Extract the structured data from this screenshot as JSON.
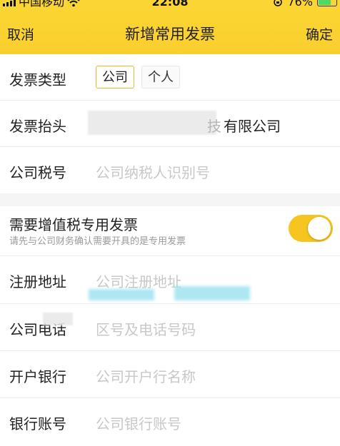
{
  "status_bar": {
    "carrier": "中国移动",
    "time": "22:08",
    "battery_percent": "76%",
    "battery_level": 0.76,
    "icons": [
      "signal-icon",
      "wifi-icon",
      "orientation-lock-icon",
      "battery-icon"
    ]
  },
  "nav": {
    "cancel_label": "取消",
    "title": "新增常用发票",
    "confirm_label": "确定"
  },
  "form": {
    "type": {
      "label": "发票类型",
      "options": [
        "公司",
        "个人"
      ],
      "selected": "公司"
    },
    "header": {
      "label": "发票抬头",
      "value_visible": "有限公司",
      "partial_char": "技"
    },
    "tax_id": {
      "label": "公司税号",
      "placeholder": "公司纳税人识别号"
    }
  },
  "vat": {
    "title": "需要增值税专用发票",
    "subtitle": "请先与公司财务确认需要开具的是专用发票",
    "enabled": true
  },
  "details": {
    "address": {
      "label": "注册地址",
      "placeholder": "公司注册地址"
    },
    "phone": {
      "label": "公司电话",
      "placeholder": "区号及电话号码"
    },
    "bank": {
      "label": "开户银行",
      "placeholder": "公司开户行名称"
    },
    "account": {
      "label": "银行账号",
      "placeholder": "公司银行账号"
    }
  },
  "colors": {
    "brand_yellow": "#fbd533",
    "toggle_on": "#f6c51f",
    "selected_border": "#f1b928",
    "placeholder": "#c8c8c8"
  }
}
